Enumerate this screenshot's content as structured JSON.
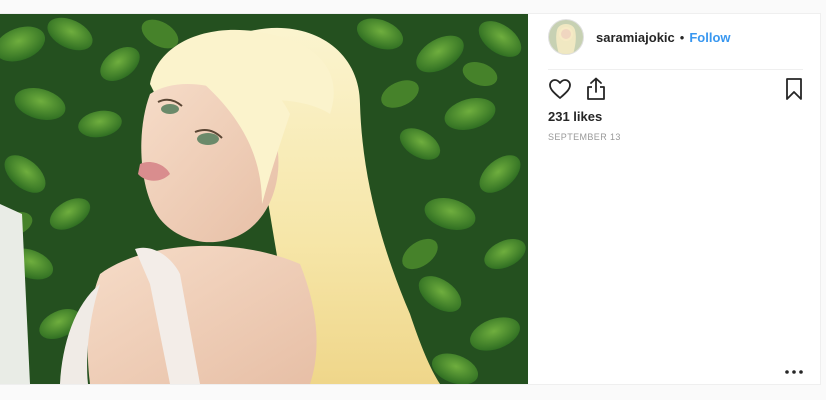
{
  "post": {
    "image_description_icon": "photo",
    "username": "saramiajokic",
    "separator": "•",
    "follow_label": "Follow",
    "likes_text": "231 likes",
    "date_text": "SEPTEMBER 13"
  },
  "icons": {
    "like": "heart-icon",
    "share": "share-icon",
    "save": "bookmark-icon",
    "more": "more-options-icon"
  },
  "colors": {
    "link": "#3897f0",
    "text": "#262626",
    "muted": "#999999"
  }
}
